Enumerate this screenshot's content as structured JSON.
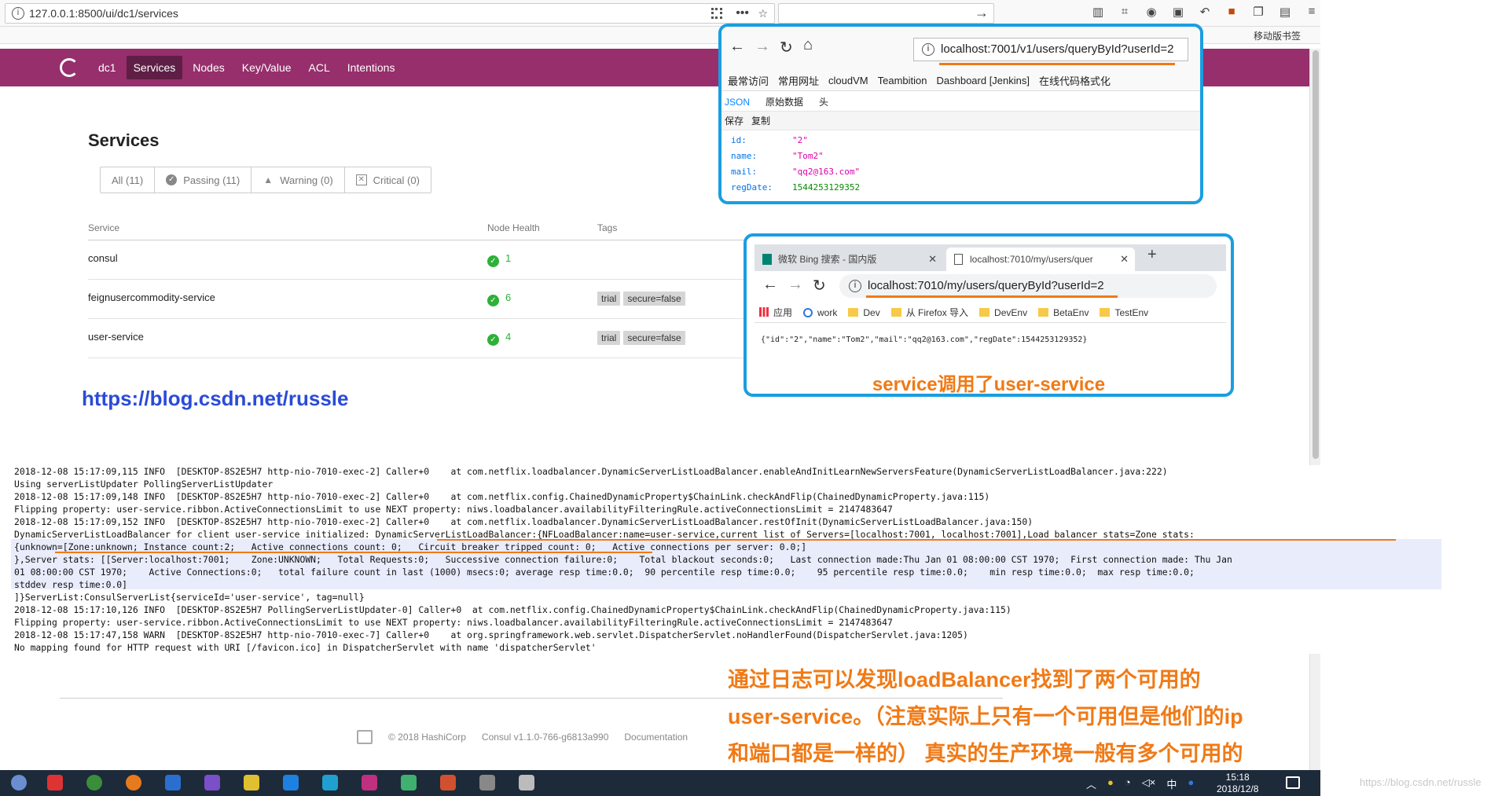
{
  "browser": {
    "url": "127.0.0.1:8500/ui/dc1/services",
    "mobile_bookmarks": "移动版书签"
  },
  "consul": {
    "dc": "dc1",
    "nav": [
      "Services",
      "Nodes",
      "Key/Value",
      "ACL",
      "Intentions"
    ],
    "active_nav": "Services",
    "page_title": "Services",
    "filters": [
      {
        "label": "All (11)",
        "icon": "none"
      },
      {
        "label": "Passing (11)",
        "icon": "check-circle-icon"
      },
      {
        "label": "Warning (0)",
        "icon": "warning-triangle-icon"
      },
      {
        "label": "Critical (0)",
        "icon": "x-box-icon"
      }
    ],
    "table": {
      "headers": [
        "Service",
        "Node Health",
        "Tags"
      ],
      "rows": [
        {
          "service": "consul",
          "health": "1",
          "tags": []
        },
        {
          "service": "feignusercommodity-service",
          "health": "6",
          "tags": [
            "trial",
            "secure=false"
          ]
        },
        {
          "service": "user-service",
          "health": "4",
          "tags": [
            "trial",
            "secure=false"
          ]
        }
      ]
    },
    "health_color": "#2eb039",
    "header_color": "#962f6c"
  },
  "blog_link": "https://blog.csdn.net/russle",
  "popup1": {
    "url": "localhost:7001/v1/users/queryById?userId=2",
    "bookmarks": [
      "最常访问",
      "常用网址",
      "cloudVM",
      "Teambition",
      "Dashboard [Jenkins]",
      "在线代码格式化"
    ],
    "tabs": [
      "JSON",
      "原始数据",
      "头"
    ],
    "actions": [
      "保存",
      "复制"
    ],
    "json": [
      {
        "key": "id:",
        "value": "\"2\"",
        "type": "str"
      },
      {
        "key": "name:",
        "value": "\"Tom2\"",
        "type": "str"
      },
      {
        "key": "mail:",
        "value": "\"qq2@163.com\"",
        "type": "str"
      },
      {
        "key": "regDate:",
        "value": "1544253129352",
        "type": "num"
      }
    ]
  },
  "popup2": {
    "tabs": [
      {
        "label": "微软 Bing 搜索 - 国内版"
      },
      {
        "label": "localhost:7010/my/users/quer"
      }
    ],
    "url": "localhost:7010/my/users/queryById?userId=2",
    "bookmarks": [
      "应用",
      "work",
      "Dev",
      "从 Firefox 导入",
      "DevEnv",
      "BetaEnv",
      "TestEnv"
    ],
    "body": "{\"id\":\"2\",\"name\":\"Tom2\",\"mail\":\"qq2@163.com\",\"regDate\":1544253129352}",
    "caption": "service调用了user-service"
  },
  "console": {
    "lines": [
      "2018-12-08 15:17:09,115 INFO  [DESKTOP-8S2E5H7 http-nio-7010-exec-2] Caller+0    at com.netflix.loadbalancer.DynamicServerListLoadBalancer.enableAndInitLearnNewServersFeature(DynamicServerListLoadBalancer.java:222)",
      "Using serverListUpdater PollingServerListUpdater",
      "2018-12-08 15:17:09,148 INFO  [DESKTOP-8S2E5H7 http-nio-7010-exec-2] Caller+0    at com.netflix.config.ChainedDynamicProperty$ChainLink.checkAndFlip(ChainedDynamicProperty.java:115)",
      "Flipping property: user-service.ribbon.ActiveConnectionsLimit to use NEXT property: niws.loadbalancer.availabilityFilteringRule.activeConnectionsLimit = 2147483647",
      "2018-12-08 15:17:09,152 INFO  [DESKTOP-8S2E5H7 http-nio-7010-exec-2] Caller+0    at com.netflix.loadbalancer.DynamicServerListLoadBalancer.restOfInit(DynamicServerListLoadBalancer.java:150)",
      "DynamicServerListLoadBalancer for client user-service initialized: DynamicServerListLoadBalancer:{NFLoadBalancer:name=user-service,current list of Servers=[localhost:7001, localhost:7001],Load balancer stats=Zone stats:",
      "{unknown=[Zone:unknown; Instance count:2;   Active connections count: 0;   Circuit breaker tripped count: 0;   Active connections per server: 0.0;]",
      "},Server stats: [[Server:localhost:7001;    Zone:UNKNOWN;   Total Requests:0;   Successive connection failure:0;    Total blackout seconds:0;   Last connection made:Thu Jan 01 08:00:00 CST 1970;  First connection made: Thu Jan",
      "01 08:00:00 CST 1970;    Active Connections:0;   total failure count in last (1000) msecs:0; average resp time:0.0;  90 percentile resp time:0.0;    95 percentile resp time:0.0;    min resp time:0.0;  max resp time:0.0;",
      "stddev resp time:0.0]",
      "]}ServerList:ConsulServerList{serviceId='user-service', tag=null}",
      "2018-12-08 15:17:10,126 INFO  [DESKTOP-8S2E5H7 PollingServerListUpdater-0] Caller+0  at com.netflix.config.ChainedDynamicProperty$ChainLink.checkAndFlip(ChainedDynamicProperty.java:115)",
      "Flipping property: user-service.ribbon.ActiveConnectionsLimit to use NEXT property: niws.loadbalancer.availabilityFilteringRule.activeConnectionsLimit = 2147483647",
      "2018-12-08 15:17:47,158 WARN  [DESKTOP-8S2E5H7 http-nio-7010-exec-7] Caller+0    at org.springframework.web.servlet.DispatcherServlet.noHandlerFound(DispatcherServlet.java:1205)",
      "No mapping found for HTTP request with URI [/favicon.ico] in DispatcherServlet with name 'dispatcherServlet'"
    ]
  },
  "footer": {
    "copyright": "© 2018 HashiCorp",
    "version": "Consul v1.1.0-766-g6813a990",
    "docs": "Documentation"
  },
  "annotation": "通过日志可以发现loadBalancer找到了两个可用的user-service。（注意实际上只有一个可用但是他们的ip和端口都是一样的） 真实的生产环境一般有多个可用的",
  "taskbar": {
    "time": "15:18",
    "date": "2018/12/8",
    "ime": "中"
  },
  "watermark": "https://blog.csdn.net/russle",
  "accent_color": "#f07a16",
  "frame_color": "#1a9ee0"
}
